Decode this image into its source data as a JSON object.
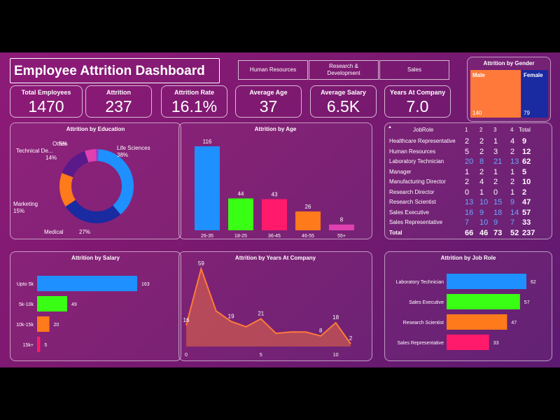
{
  "title": "Employee Attrition Dashboard",
  "slicers": [
    "Human Resources",
    "Research & Development",
    "Sales"
  ],
  "kpis": [
    {
      "label": "Total Employees",
      "value": "1470"
    },
    {
      "label": "Attrition",
      "value": "237"
    },
    {
      "label": "Attrition Rate",
      "value": "16.1%"
    },
    {
      "label": "Average Age",
      "value": "37"
    },
    {
      "label": "Average Salary",
      "value": "6.5K"
    },
    {
      "label": "Years At Company",
      "value": "7.0"
    }
  ],
  "colors": {
    "blue": "#1e90ff",
    "green": "#39ff14",
    "pink": "#ff1a6b",
    "orange": "#ff7a1a",
    "magenta": "#e040b0",
    "navy": "#1a2aa0",
    "purple": "#5a1a8a"
  },
  "gender": {
    "title": "Attrition by Gender",
    "male": {
      "label": "Male",
      "value": "140"
    },
    "female": {
      "label": "Female",
      "value": "79"
    }
  },
  "chart_data": [
    {
      "id": "education",
      "type": "pie",
      "title": "Attrition by Education",
      "slices": [
        {
          "label": "Life Sciences",
          "pct": "38%",
          "value": 38,
          "color": "#1e90ff"
        },
        {
          "label": "Medical",
          "pct": "27%",
          "value": 27,
          "color": "#1a2aa0"
        },
        {
          "label": "Marketing",
          "pct": "15%",
          "value": 15,
          "color": "#ff7a1a"
        },
        {
          "label": "Technical De...",
          "pct": "14%",
          "value": 14,
          "color": "#5a1a8a"
        },
        {
          "label": "Other",
          "pct": "5%",
          "value": 5,
          "color": "#e040b0"
        },
        {
          "label": "",
          "pct": "",
          "value": 1,
          "color": "#9a3ad0"
        }
      ]
    },
    {
      "id": "age",
      "type": "bar",
      "title": "Attrition by Age",
      "categories": [
        "26-35",
        "18-25",
        "36-45",
        "46-55",
        "55+"
      ],
      "values": [
        116,
        44,
        43,
        26,
        8
      ],
      "colors": [
        "#1e90ff",
        "#39ff14",
        "#ff1a6b",
        "#ff7a1a",
        "#e040b0"
      ]
    },
    {
      "id": "salary",
      "type": "bar",
      "title": "Attrition by Salary",
      "categories": [
        "Upto 5k",
        "5k-10k",
        "10k-15k",
        "15k+"
      ],
      "values": [
        163,
        49,
        20,
        5
      ],
      "colors": [
        "#1e90ff",
        "#39ff14",
        "#ff7a1a",
        "#ff1a6b"
      ]
    },
    {
      "id": "years",
      "type": "area",
      "title": "Attrition by Years At Company",
      "x": [
        0,
        1,
        2,
        3,
        4,
        5,
        6,
        7,
        8,
        9,
        10,
        11
      ],
      "values": [
        16,
        59,
        27,
        19,
        15,
        21,
        10,
        11,
        11,
        8,
        18,
        2
      ],
      "labels": {
        "0": "16",
        "1": "59",
        "3": "19",
        "5": "21",
        "9": "8",
        "10": "18",
        "11": "2"
      },
      "xticks": [
        "0",
        "5",
        "10"
      ]
    },
    {
      "id": "jobrole",
      "type": "bar",
      "title": "Attrition by Job Role",
      "categories": [
        "Laboratory Technician",
        "Sales Executive",
        "Research Scientist",
        "Sales Representative"
      ],
      "values": [
        62,
        57,
        47,
        33
      ],
      "colors": [
        "#1e90ff",
        "#39ff14",
        "#ff7a1a",
        "#ff1a6b"
      ]
    }
  ],
  "matrix": {
    "headers": [
      "JobRole",
      "1",
      "2",
      "3",
      "4",
      "Total"
    ],
    "rows": [
      {
        "role": "Healthcare Representative",
        "vals": [
          "2",
          "2",
          "1",
          "4"
        ],
        "total": "9"
      },
      {
        "role": "Human Resources",
        "vals": [
          "5",
          "2",
          "3",
          "2"
        ],
        "total": "12"
      },
      {
        "role": "Laboratory Technician",
        "vals": [
          "20",
          "8",
          "21",
          "13"
        ],
        "total": "62"
      },
      {
        "role": "Manager",
        "vals": [
          "1",
          "2",
          "1",
          "1"
        ],
        "total": "5"
      },
      {
        "role": "Manufacturing Director",
        "vals": [
          "2",
          "4",
          "2",
          "2"
        ],
        "total": "10"
      },
      {
        "role": "Research Director",
        "vals": [
          "0",
          "1",
          "0",
          "1"
        ],
        "total": "2"
      },
      {
        "role": "Research Scientist",
        "vals": [
          "13",
          "10",
          "15",
          "9"
        ],
        "total": "47"
      },
      {
        "role": "Sales Executive",
        "vals": [
          "16",
          "9",
          "18",
          "14"
        ],
        "total": "57"
      },
      {
        "role": "Sales Representative",
        "vals": [
          "7",
          "10",
          "9",
          "7"
        ],
        "total": "33"
      }
    ],
    "total_row": {
      "role": "Total",
      "vals": [
        "66",
        "46",
        "73",
        "52"
      ],
      "total": "237"
    }
  }
}
